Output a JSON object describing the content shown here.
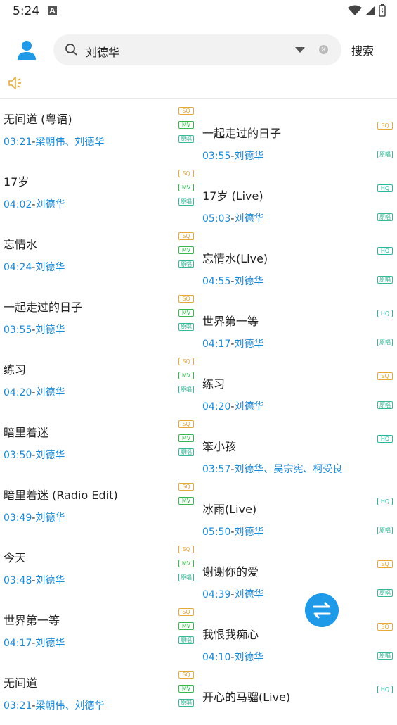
{
  "status_bar": {
    "time": "5:24",
    "notif_glyph": "A"
  },
  "search": {
    "query": "刘德华",
    "button_label": "搜索"
  },
  "left_list": [
    {
      "title": "无间道 (粤语)",
      "duration": "03:21",
      "artist": "梁朝伟、刘德华",
      "badges": [
        "SQ",
        "MV",
        "原唱"
      ]
    },
    {
      "title": "17岁",
      "duration": "04:02",
      "artist": "刘德华",
      "badges": [
        "SQ",
        "MV",
        "原唱"
      ]
    },
    {
      "title": "忘情水",
      "duration": "04:24",
      "artist": "刘德华",
      "badges": [
        "SQ",
        "MV",
        "原唱"
      ]
    },
    {
      "title": "一起走过的日子",
      "duration": "03:55",
      "artist": "刘德华",
      "badges": [
        "SQ",
        "MV",
        "原唱"
      ]
    },
    {
      "title": "练习",
      "duration": "04:20",
      "artist": "刘德华",
      "badges": [
        "SQ",
        "MV",
        "原唱"
      ]
    },
    {
      "title": "暗里着迷",
      "duration": "03:50",
      "artist": "刘德华",
      "badges": [
        "SQ",
        "MV",
        "原唱"
      ]
    },
    {
      "title": "暗里着迷 (Radio Edit)",
      "duration": "03:49",
      "artist": "刘德华",
      "badges": [
        "SQ",
        "MV"
      ]
    },
    {
      "title": "今天",
      "duration": "03:48",
      "artist": "刘德华",
      "badges": [
        "SQ",
        "MV",
        "原唱"
      ]
    },
    {
      "title": "世界第一等",
      "duration": "04:17",
      "artist": "刘德华",
      "badges": [
        "SQ",
        "MV",
        "原唱"
      ]
    },
    {
      "title": "无间道",
      "duration": "03:21",
      "artist": "梁朝伟、刘德华",
      "badges": [
        "SQ",
        "MV",
        "原唱"
      ]
    }
  ],
  "right_list": [
    {
      "title": "一起走过的日子",
      "duration": "03:55",
      "artist": "刘德华",
      "badges": [
        "SQ",
        "原唱"
      ]
    },
    {
      "title": "17岁 (Live)",
      "duration": "05:03",
      "artist": "刘德华",
      "badges": [
        "HQ",
        "原唱"
      ]
    },
    {
      "title": "忘情水(Live)",
      "duration": "04:55",
      "artist": "刘德华",
      "badges": [
        "HQ",
        "原唱"
      ]
    },
    {
      "title": "世界第一等",
      "duration": "04:17",
      "artist": "刘德华",
      "badges": [
        "HQ",
        "原唱"
      ]
    },
    {
      "title": "练习",
      "duration": "04:20",
      "artist": "刘德华",
      "badges": [
        "SQ",
        "原唱"
      ]
    },
    {
      "title": "笨小孩",
      "duration": "03:57",
      "artist": "刘德华、吴宗宪、柯受良",
      "badges": [
        "HQ"
      ]
    },
    {
      "title": "冰雨(Live)",
      "duration": "05:50",
      "artist": "刘德华",
      "badges": [
        "HQ",
        "原唱"
      ]
    },
    {
      "title": "谢谢你的爱",
      "duration": "04:39",
      "artist": "刘德华",
      "badges": [
        "SQ",
        "原唱"
      ]
    },
    {
      "title": "我恨我痴心",
      "duration": "04:10",
      "artist": "刘德华",
      "badges": [
        "SQ",
        "原唱"
      ]
    },
    {
      "title": "开心的马骝(Live)",
      "duration": "",
      "artist": "",
      "badges": [
        "HQ"
      ]
    }
  ],
  "meta_separator": "-",
  "colors": {
    "accent": "#1a8ad4",
    "sq": "#e6a93b",
    "hq": "#2bb5a0",
    "mv": "#37b84a",
    "fab": "#1f9ae8"
  },
  "icons": {
    "avatar": "person-icon",
    "search": "search-icon",
    "speaker": "speaker-icon",
    "fab": "swap-icon"
  }
}
